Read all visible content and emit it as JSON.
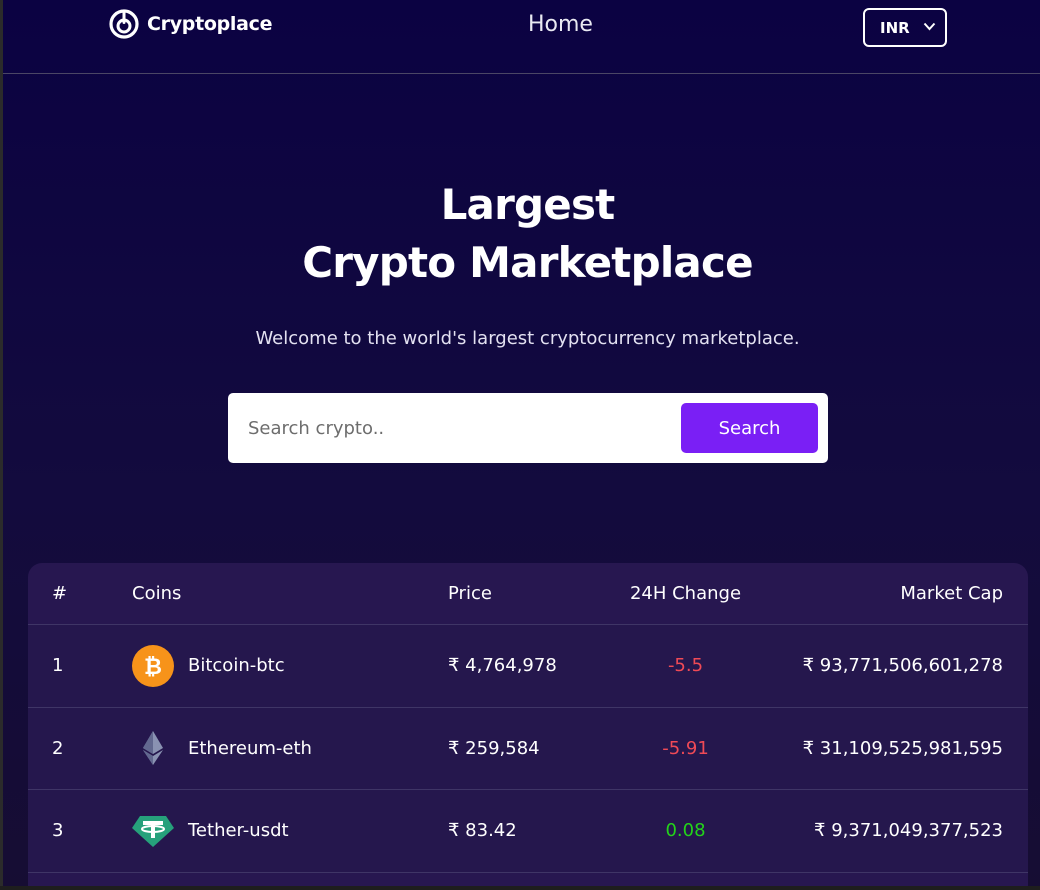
{
  "navbar": {
    "brand": "Cryptoplace",
    "home_label": "Home",
    "currency_selected": "INR"
  },
  "hero": {
    "title_line1": "Largest",
    "title_line2": "Crypto Marketplace",
    "subtitle": "Welcome to the world's largest cryptocurrency marketplace."
  },
  "search": {
    "placeholder": "Search crypto..",
    "button_label": "Search",
    "accent_color": "#7a1ff5"
  },
  "table": {
    "headers": {
      "rank": "#",
      "coins": "Coins",
      "price": "Price",
      "change": "24H Change",
      "market_cap": "Market Cap"
    },
    "rows": [
      {
        "rank": "1",
        "coin": "Bitcoin-btc",
        "icon": "bitcoin-icon",
        "price": "₹ 4,764,978",
        "change": "-5.5",
        "trend": "negative",
        "market_cap": "₹ 93,771,506,601,278"
      },
      {
        "rank": "2",
        "coin": "Ethereum-eth",
        "icon": "ethereum-icon",
        "price": "₹ 259,584",
        "change": "-5.91",
        "trend": "negative",
        "market_cap": "₹ 31,109,525,981,595"
      },
      {
        "rank": "3",
        "coin": "Tether-usdt",
        "icon": "tether-icon",
        "price": "₹ 83.42",
        "change": "0.08",
        "trend": "positive",
        "market_cap": "₹ 9,371,049,377,523"
      }
    ]
  },
  "colors": {
    "negative": "#f04a56",
    "positive": "#23d31a",
    "background": "#0b0242"
  }
}
